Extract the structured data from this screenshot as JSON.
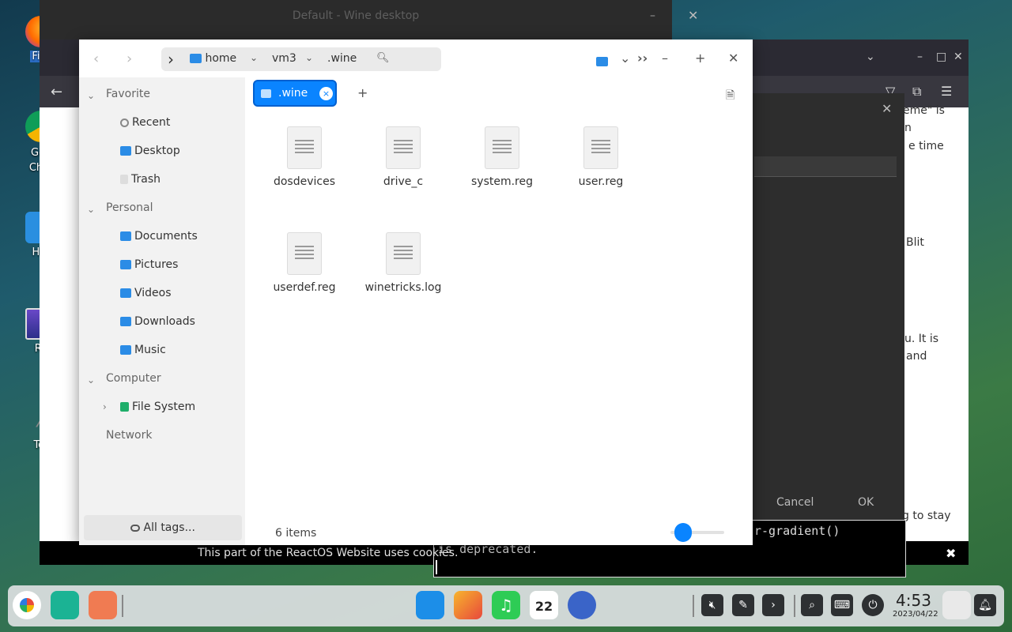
{
  "desktop": {
    "icons": [
      {
        "label": "Fire"
      },
      {
        "label": "Goo Chro"
      },
      {
        "label": "Hor"
      },
      {
        "label": "Ro"
      },
      {
        "label": "Ter"
      }
    ]
  },
  "wine_window": {
    "title": "Default - Wine desktop",
    "minimize": "–",
    "close": "✕"
  },
  "browser": {
    "text_fragments": [
      "eme\" is",
      "n",
      "e time",
      "Blit",
      "u. It is",
      "and",
      "g to stay"
    ],
    "dialog": {
      "cancel_label": "Cancel",
      "ok_label": "OK",
      "close": "✕"
    },
    "console": {
      "line1": "r-gradient()",
      "line2": "is deprecated."
    },
    "cookie_banner": {
      "text": "This part of the ReactOS Website uses cookies.",
      "close": "✖"
    }
  },
  "file_manager": {
    "nav": {
      "back": "‹",
      "forward": "›"
    },
    "breadcrumb": [
      "home",
      "vm3",
      ".wine"
    ],
    "window_controls": {
      "more": "››",
      "minimize": "–",
      "maximize": "+",
      "close": "✕"
    },
    "sidebar": {
      "groups": [
        {
          "label": "Favorite",
          "items": [
            "Recent",
            "Desktop",
            "Trash"
          ]
        },
        {
          "label": "Personal",
          "items": [
            "Documents",
            "Pictures",
            "Videos",
            "Downloads",
            "Music"
          ]
        },
        {
          "label": "Computer",
          "items": [
            "File System"
          ]
        },
        {
          "label": "Network",
          "items": []
        }
      ],
      "tags_label": "All tags..."
    },
    "tabs": [
      {
        "label": ".wine",
        "close": "×"
      }
    ],
    "add_tab": "+",
    "files": [
      "dosdevices",
      "drive_c",
      "system.reg",
      "user.reg",
      "userdef.reg",
      "winetricks.log"
    ],
    "status": "6 items",
    "zoom_level": 0.1
  },
  "taskbar": {
    "calendar_day": "22",
    "clock_time": "4:53",
    "clock_date": "2023/04/22"
  },
  "colors": {
    "accent": "#0a84ff",
    "folder": "#2b8ce6"
  }
}
